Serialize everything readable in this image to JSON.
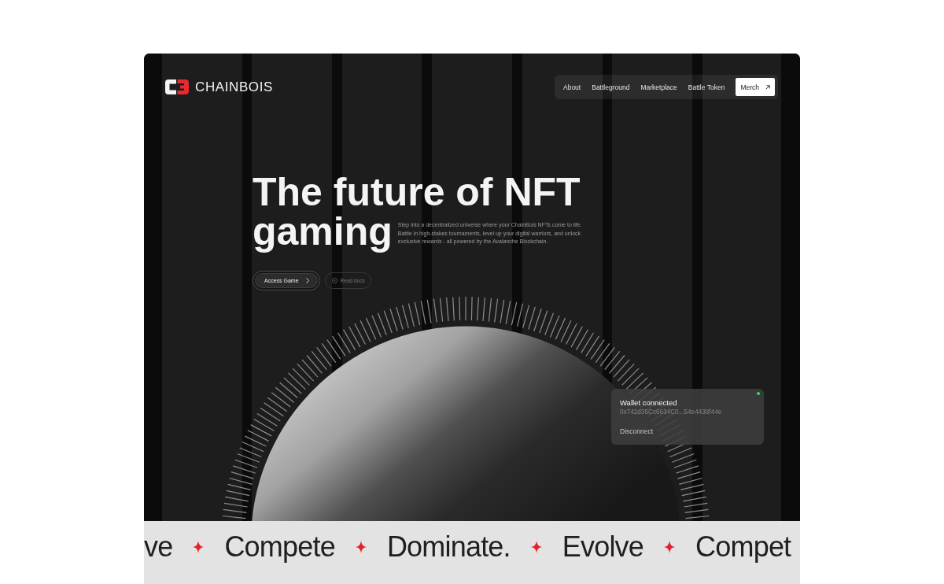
{
  "logo": {
    "wordmark": "CHAINBOIS"
  },
  "nav": {
    "links": [
      "About",
      "Battleground",
      "Marketplace",
      "Battle Token"
    ],
    "button": "Merch"
  },
  "hero": {
    "title_lines": [
      "The future of NFT",
      "gaming"
    ],
    "description": "Step into a decentralized universe where your ChainBois NFTs come to life. Battle in high-stakes tournaments, level up your digital warriors, and unlock exclusive rewards - all powered by the Avalanche Blockchain.",
    "buttons": [
      {
        "label": "Access Game",
        "kind": "primary"
      },
      {
        "label": "Read docs",
        "kind": "secondary"
      }
    ]
  },
  "wallet": {
    "title": "Wallet connected",
    "address": "0x742d35Cc6634C0...54e4438f44e",
    "action": "Disconnect"
  },
  "ticker": {
    "words": [
      "ve",
      "Compete",
      "Dominate.",
      "Evolve",
      "Compet"
    ]
  }
}
